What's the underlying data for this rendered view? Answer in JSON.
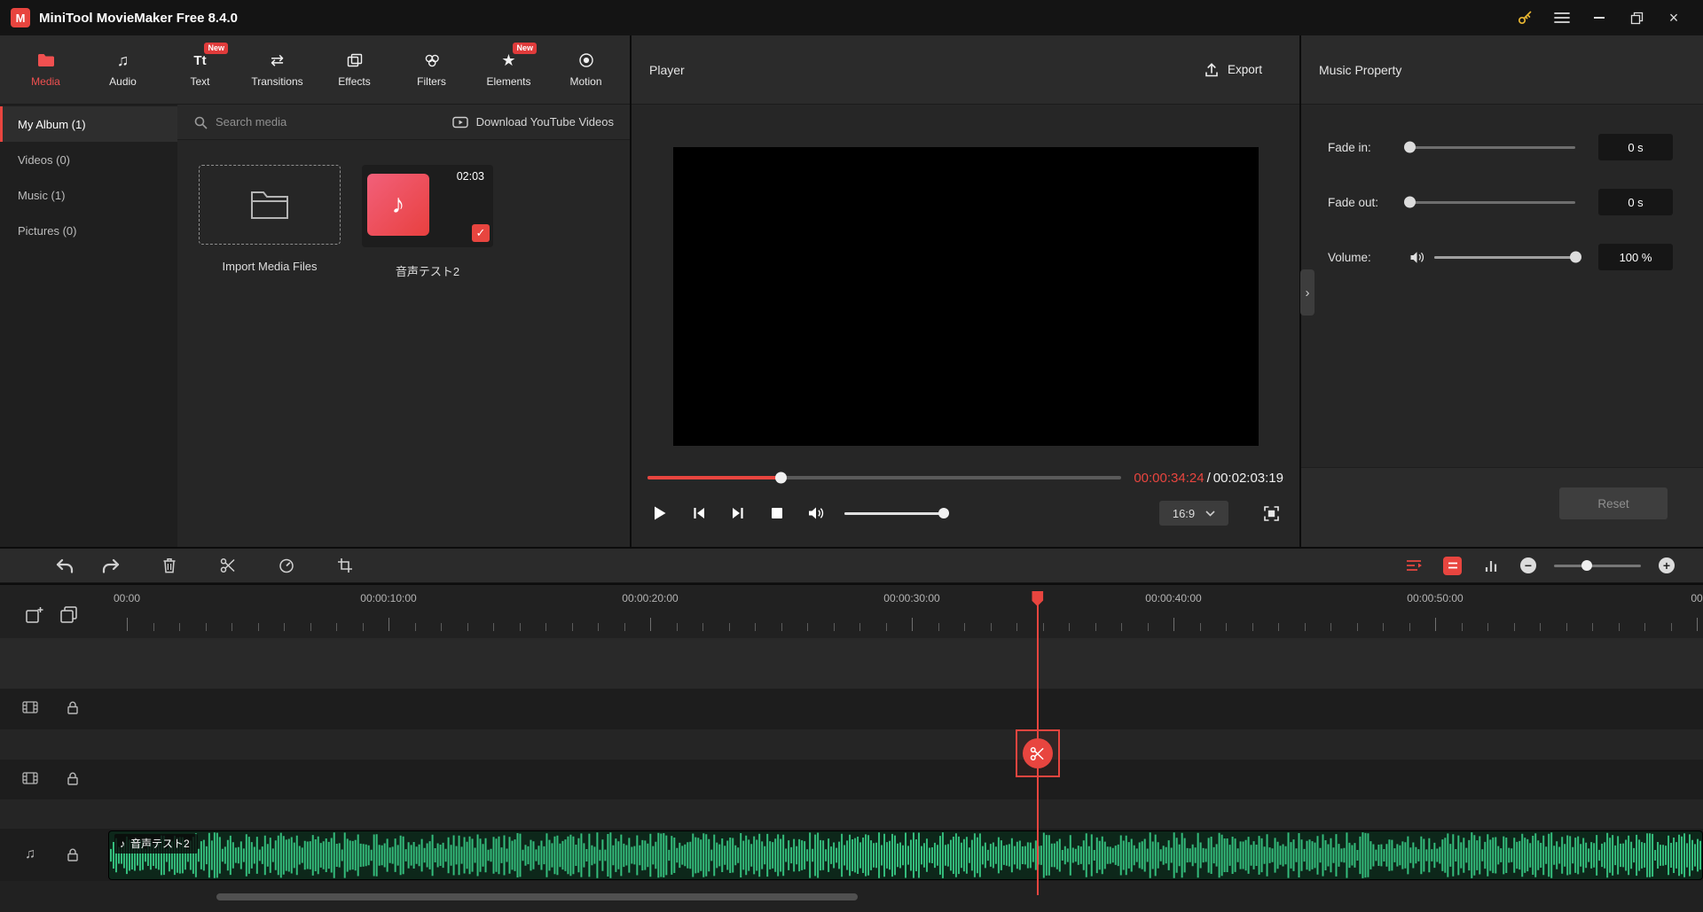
{
  "titlebar": {
    "title": "MiniTool MovieMaker Free 8.4.0"
  },
  "tabs": [
    {
      "label": "Media",
      "icon": "folder-icon",
      "active": true
    },
    {
      "label": "Audio",
      "icon": "music-note-icon"
    },
    {
      "label": "Text",
      "icon": "text-icon",
      "badge": "New"
    },
    {
      "label": "Transitions",
      "icon": "transitions-icon"
    },
    {
      "label": "Effects",
      "icon": "effects-icon"
    },
    {
      "label": "Filters",
      "icon": "filters-icon"
    },
    {
      "label": "Elements",
      "icon": "elements-icon",
      "badge": "New"
    },
    {
      "label": "Motion",
      "icon": "motion-icon"
    }
  ],
  "library": {
    "albums": [
      {
        "label": "My Album (1)",
        "active": true
      },
      {
        "label": "Videos (0)"
      },
      {
        "label": "Music (1)"
      },
      {
        "label": "Pictures (0)"
      }
    ],
    "search_placeholder": "Search media",
    "download_link": "Download YouTube Videos",
    "import_label": "Import Media Files",
    "media_item": {
      "name": "音声テスト2",
      "duration": "02:03"
    }
  },
  "player": {
    "title": "Player",
    "export_label": "Export",
    "current_time": "00:00:34:24",
    "time_separator": "/",
    "total_time": "00:02:03:19",
    "aspect_ratio": "16:9",
    "progress_pct": 28,
    "volume_pct": 95
  },
  "properties": {
    "title": "Music Property",
    "rows": {
      "fade_in": {
        "label": "Fade in:",
        "value": "0 s",
        "pct": 0
      },
      "fade_out": {
        "label": "Fade out:",
        "value": "0 s",
        "pct": 0
      },
      "volume": {
        "label": "Volume:",
        "value": "100 %",
        "pct": 100
      }
    },
    "reset_label": "Reset"
  },
  "timeline": {
    "ruler_labels": [
      "00:00",
      "00:00:10:00",
      "00:00:20:00",
      "00:00:30:00",
      "00:00:40:00",
      "00:00:50:00",
      "00"
    ],
    "playhead_seconds": 34.8,
    "clip": {
      "name": "音声テスト2"
    }
  },
  "colors": {
    "accent_red": "#e8453f",
    "waveform_green": "#34bd7c",
    "clip_bg": "#0d271a"
  }
}
